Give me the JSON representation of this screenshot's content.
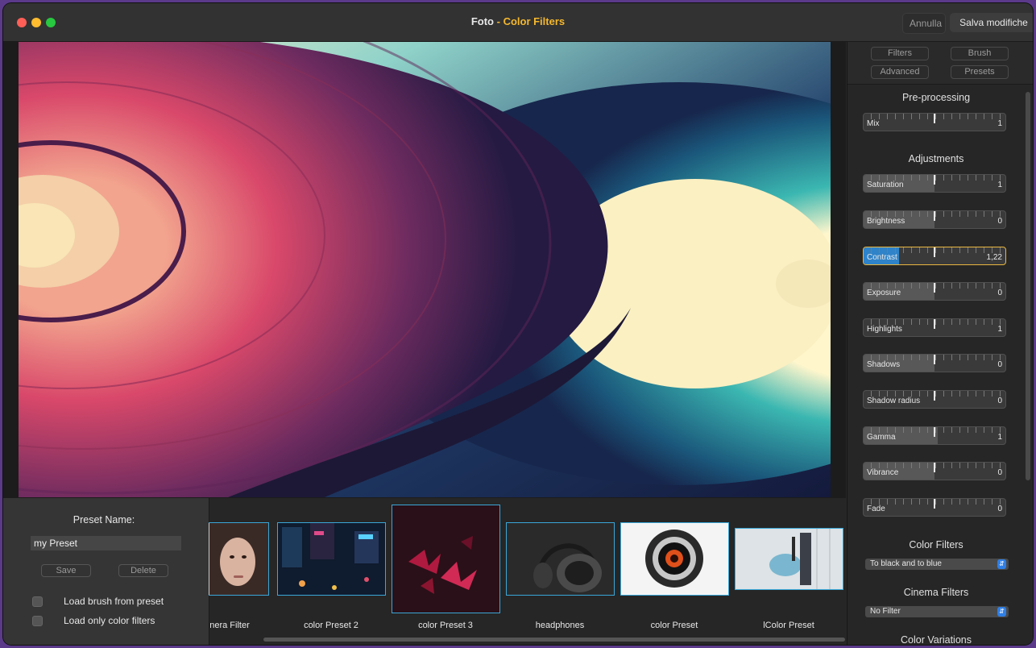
{
  "window": {
    "title_app": "Foto",
    "title_sep": " - ",
    "title_section": "Color Filters",
    "cancel_label": "Annulla",
    "save_label": "Salva modifiche"
  },
  "tabs": [
    "Filters",
    "Brush",
    "Advanced",
    "Presets"
  ],
  "sections": {
    "preprocessing": "Pre-processing",
    "adjustments": "Adjustments",
    "color_filters": "Color Filters",
    "cinema_filters": "Cinema Filters",
    "color_variations": "Color Variations"
  },
  "sliders": [
    {
      "label": "Mix",
      "value": "1",
      "level": 0.0
    },
    {
      "label": "Saturation",
      "value": "1",
      "level": 0.5
    },
    {
      "label": "Brightness",
      "value": "0",
      "level": 0.5
    },
    {
      "label": "Contrast",
      "value": "1,22",
      "level": 0.25,
      "active": true
    },
    {
      "label": "Exposure",
      "value": "0",
      "level": 0.5
    },
    {
      "label": "Highlights",
      "value": "1",
      "level": 0.0
    },
    {
      "label": "Shadows",
      "value": "0",
      "level": 0.5
    },
    {
      "label": "Shadow radius",
      "value": "0",
      "level": 0.0
    },
    {
      "label": "Gamma",
      "value": "1",
      "level": 0.52
    },
    {
      "label": "Vibrance",
      "value": "0",
      "level": 0.5
    },
    {
      "label": "Fade",
      "value": "0",
      "level": 0.0
    }
  ],
  "color_filter_select": "To black and to blue",
  "cinema_filter_select": "No Filter",
  "preset": {
    "name_label": "Preset Name:",
    "name_value": "my Preset",
    "save_label": "Save",
    "delete_label": "Delete",
    "check_brush": "Load brush from preset",
    "check_color": "Load only color filters"
  },
  "thumbnails": [
    {
      "label": "nera Filter",
      "theme": "portrait"
    },
    {
      "label": "color Preset 2",
      "theme": "city"
    },
    {
      "label": "color Preset 3",
      "theme": "leaves"
    },
    {
      "label": "headphones",
      "theme": "headphones"
    },
    {
      "label": "color Preset",
      "theme": "lens"
    },
    {
      "label": "lColor Preset",
      "theme": "guitar"
    }
  ],
  "colors": {
    "accent": "#f5b82e",
    "selection": "#3aa7d8",
    "slider_active": "#2f83c8"
  }
}
